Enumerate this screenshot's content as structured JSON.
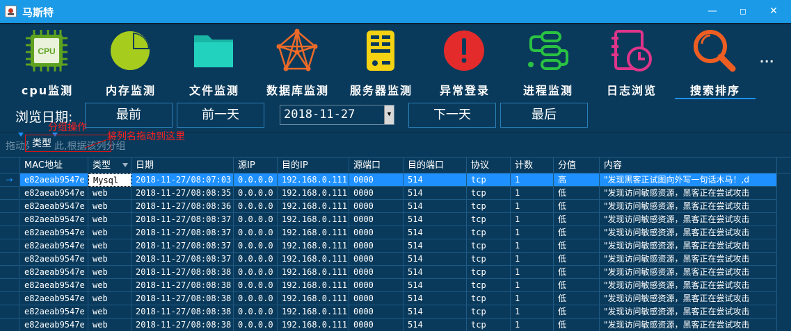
{
  "window": {
    "title": "马斯特"
  },
  "toolbar": {
    "items": [
      {
        "label": "cpu监测",
        "icon": "cpu-chip-icon",
        "color": "#5fa21f",
        "active": false
      },
      {
        "label": "内存监测",
        "icon": "pie-chart-icon",
        "color": "#a6cc1e",
        "active": false
      },
      {
        "label": "文件监测",
        "icon": "folder-icon",
        "color": "#19b6a6",
        "active": false
      },
      {
        "label": "数据库监测",
        "icon": "network-icon",
        "color": "#ec6a28",
        "active": false
      },
      {
        "label": "服务器监测",
        "icon": "server-icon",
        "color": "#f5d312",
        "active": false
      },
      {
        "label": "异常登录",
        "icon": "alert-icon",
        "color": "#e32b2b",
        "active": false
      },
      {
        "label": "进程监测",
        "icon": "process-icon",
        "color": "#2ac243",
        "active": false
      },
      {
        "label": "日志浏览",
        "icon": "log-calendar-icon",
        "color": "#e0348a",
        "active": false
      },
      {
        "label": "搜索排序",
        "icon": "search-icon",
        "color": "#ee5e22",
        "active": true
      }
    ],
    "more": "..."
  },
  "datebar": {
    "label": "浏览日期:",
    "first": "最前",
    "prev": "前一天",
    "date": "2018-11-27",
    "next": "下一天",
    "last": "最后"
  },
  "grouping": {
    "hint": "拖动列名至此,根据该列分组",
    "chip": "类型",
    "annotation_group": "分组操作",
    "annotation_drag": "将列名拖动到这里"
  },
  "grid": {
    "columns": [
      "MAC地址",
      "类型",
      "日期",
      "源IP",
      "目的IP",
      "源端口",
      "目的端口",
      "协议",
      "计数",
      "分值",
      "内容"
    ],
    "rows": [
      [
        "e82aeab9547e",
        "Mysql",
        "2018-11-27/08:07:03",
        "0.0.0.0",
        "192.168.0.111",
        "0000",
        "514",
        "tcp",
        "1",
        "高",
        "\"发现黑客正试图向外写一句话木马！,d"
      ],
      [
        "e82aeab9547e",
        "web",
        "2018-11-27/08:08:35",
        "0.0.0.0",
        "192.168.0.111",
        "0000",
        "514",
        "tcp",
        "1",
        "低",
        "\"发现访问敏感资源，黑客正在尝试攻击"
      ],
      [
        "e82aeab9547e",
        "web",
        "2018-11-27/08:08:36",
        "0.0.0.0",
        "192.168.0.111",
        "0000",
        "514",
        "tcp",
        "1",
        "低",
        "\"发现访问敏感资源，黑客正在尝试攻击"
      ],
      [
        "e82aeab9547e",
        "web",
        "2018-11-27/08:08:37",
        "0.0.0.0",
        "192.168.0.111",
        "0000",
        "514",
        "tcp",
        "1",
        "低",
        "\"发现访问敏感资源，黑客正在尝试攻击"
      ],
      [
        "e82aeab9547e",
        "web",
        "2018-11-27/08:08:37",
        "0.0.0.0",
        "192.168.0.111",
        "0000",
        "514",
        "tcp",
        "1",
        "低",
        "\"发现访问敏感资源，黑客正在尝试攻击"
      ],
      [
        "e82aeab9547e",
        "web",
        "2018-11-27/08:08:37",
        "0.0.0.0",
        "192.168.0.111",
        "0000",
        "514",
        "tcp",
        "1",
        "低",
        "\"发现访问敏感资源，黑客正在尝试攻击"
      ],
      [
        "e82aeab9547e",
        "web",
        "2018-11-27/08:08:37",
        "0.0.0.0",
        "192.168.0.111",
        "0000",
        "514",
        "tcp",
        "1",
        "低",
        "\"发现访问敏感资源，黑客正在尝试攻击"
      ],
      [
        "e82aeab9547e",
        "web",
        "2018-11-27/08:08:38",
        "0.0.0.0",
        "192.168.0.111",
        "0000",
        "514",
        "tcp",
        "1",
        "低",
        "\"发现访问敏感资源，黑客正在尝试攻击"
      ],
      [
        "e82aeab9547e",
        "web",
        "2018-11-27/08:08:38",
        "0.0.0.0",
        "192.168.0.111",
        "0000",
        "514",
        "tcp",
        "1",
        "低",
        "\"发现访问敏感资源，黑客正在尝试攻击"
      ],
      [
        "e82aeab9547e",
        "web",
        "2018-11-27/08:08:38",
        "0.0.0.0",
        "192.168.0.111",
        "0000",
        "514",
        "tcp",
        "1",
        "低",
        "\"发现访问敏感资源，黑客正在尝试攻击"
      ],
      [
        "e82aeab9547e",
        "web",
        "2018-11-27/08:08:38",
        "0.0.0.0",
        "192.168.0.111",
        "0000",
        "514",
        "tcp",
        "1",
        "低",
        "\"发现访问敏感资源，黑客正在尝试攻击"
      ],
      [
        "e82aeab9547e",
        "web",
        "2018-11-27/08:08:38",
        "0.0.0.0",
        "192.168.0.111",
        "0000",
        "514",
        "tcp",
        "1",
        "低",
        "\"发现访问敏感资源，黑客正在尝试攻击"
      ]
    ]
  }
}
